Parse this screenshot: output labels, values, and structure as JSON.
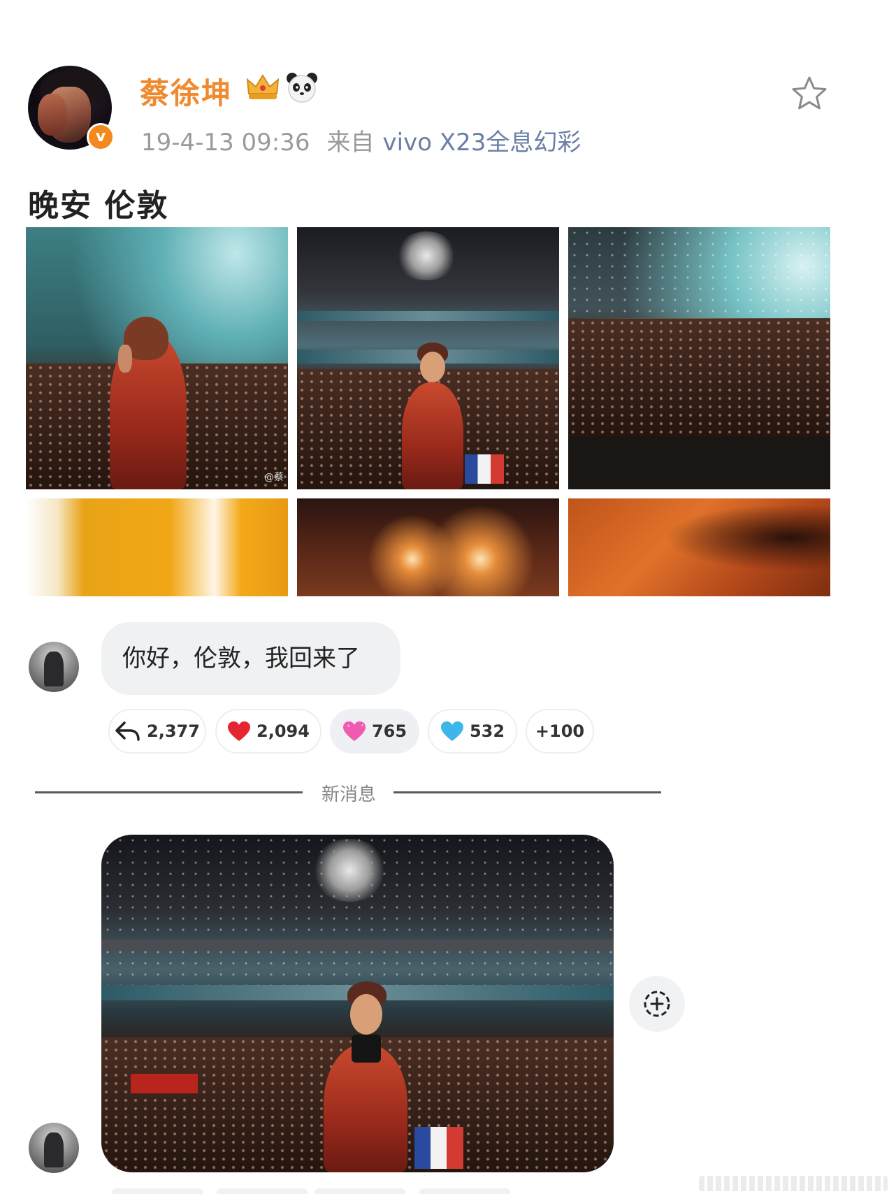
{
  "post": {
    "username": "蔡徐坤",
    "timestamp": "19-4-13 09:36",
    "from_label": "来自",
    "source": "vivo X23全息幻彩",
    "text": "晚安 伦敦",
    "watermark": "@蔡"
  },
  "comment": {
    "text": "你好，伦敦，我回来了"
  },
  "reactions": [
    {
      "icon": "reply-arrow-icon",
      "count": "2,377"
    },
    {
      "icon": "red-heart-icon",
      "count": "2,094",
      "color": "#e5252f"
    },
    {
      "icon": "pink-heart-icon",
      "count": "765",
      "color": "#f05ab0"
    },
    {
      "icon": "blue-heart-icon",
      "count": "532",
      "color": "#3fb6ea"
    },
    {
      "icon": "more",
      "count": "+100"
    }
  ],
  "divider": {
    "label": "新消息"
  },
  "colors": {
    "username": "#ef8a2e",
    "source_link": "#6a7fa6",
    "verified_badge": "#f4891e"
  }
}
